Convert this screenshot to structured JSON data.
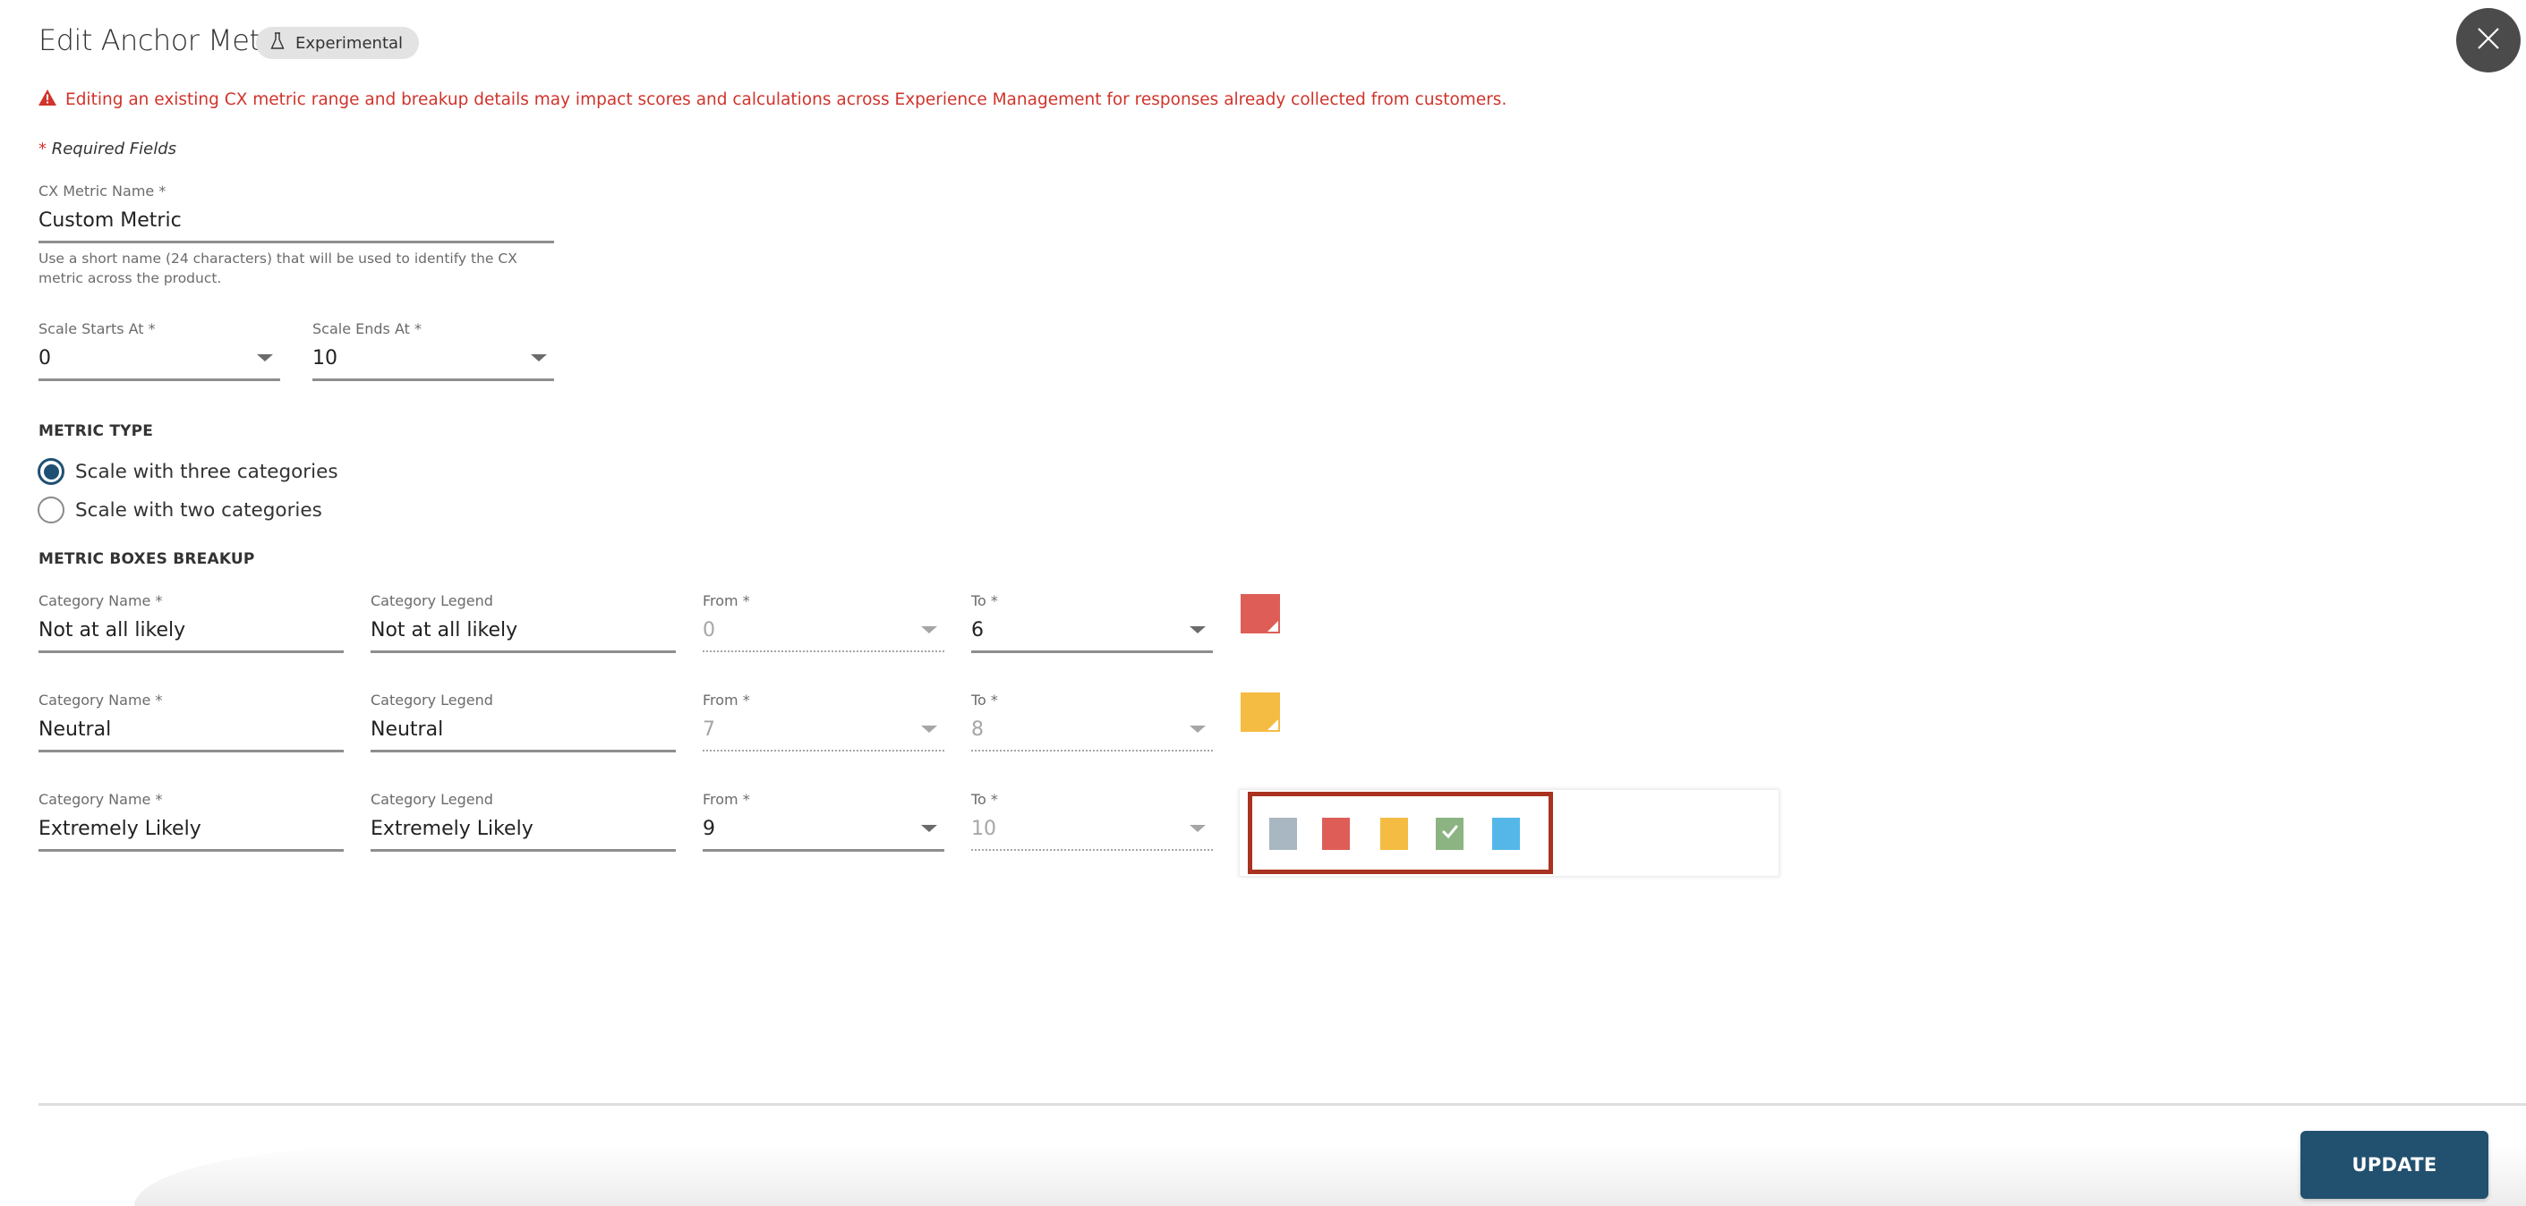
{
  "header": {
    "title": "Edit Anchor Metric",
    "badge": {
      "label": "Experimental",
      "icon": "flask-icon"
    },
    "close_icon": "close-icon"
  },
  "warning": {
    "icon": "warning-triangle-icon",
    "text": "Editing an existing CX metric range and breakup details may impact scores and calculations across Experience Management for responses already collected from customers.",
    "color": "#d0342c"
  },
  "required_note": {
    "star": "*",
    "text": " Required Fields"
  },
  "metric_name": {
    "label": "CX Metric Name *",
    "value": "Custom Metric",
    "helper": "Use a short name (24 characters) that will be used to identify the CX metric across the product."
  },
  "scale": {
    "start": {
      "label": "Scale Starts At *",
      "value": "0"
    },
    "end": {
      "label": "Scale Ends At *",
      "value": "10"
    }
  },
  "metric_type": {
    "title": "METRIC TYPE",
    "options": [
      {
        "label": "Scale with three categories",
        "checked": true
      },
      {
        "label": "Scale with two categories",
        "checked": false
      }
    ]
  },
  "breakup": {
    "title": "METRIC BOXES BREAKUP",
    "labels": {
      "name": "Category Name *",
      "legend": "Category Legend",
      "from": "From *",
      "to": "To *"
    },
    "rows": [
      {
        "name": "Not at all likely",
        "legend": "Not at all likely",
        "from": "0",
        "to": "6",
        "from_disabled": true,
        "to_disabled": false,
        "color": "#de5e57"
      },
      {
        "name": "Neutral",
        "legend": "Neutral",
        "from": "7",
        "to": "8",
        "from_disabled": true,
        "to_disabled": true,
        "color": "#f4bc42"
      },
      {
        "name": "Extremely Likely",
        "legend": "Extremely Likely",
        "from": "9",
        "to": "10",
        "from_disabled": false,
        "to_disabled": true,
        "color": "#8bb482"
      }
    ]
  },
  "color_palette": {
    "options": [
      {
        "name": "gray",
        "color": "#a8b7c1",
        "selected": false
      },
      {
        "name": "red",
        "color": "#de5e57",
        "selected": false
      },
      {
        "name": "yellow",
        "color": "#f4bc42",
        "selected": false
      },
      {
        "name": "green",
        "color": "#8bb482",
        "selected": true
      },
      {
        "name": "blue",
        "color": "#55b7e8",
        "selected": false
      }
    ],
    "highlight_color": "#a93220"
  },
  "footer": {
    "update_label": "UPDATE",
    "update_color": "#22506f"
  }
}
